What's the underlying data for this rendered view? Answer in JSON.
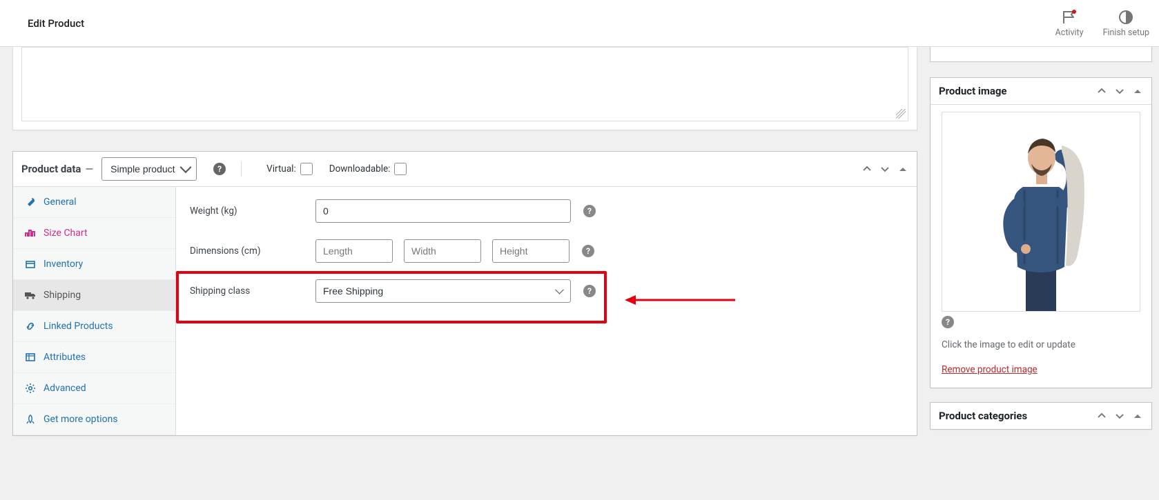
{
  "topbar": {
    "title": "Edit Product",
    "activity_label": "Activity",
    "finish_label": "Finish setup"
  },
  "product_data": {
    "title": "Product data",
    "dash": " — ",
    "type_select": "Simple product",
    "virtual_label": "Virtual:",
    "downloadable_label": "Downloadable:"
  },
  "tabs": {
    "general": "General",
    "size_chart": "Size Chart",
    "inventory": "Inventory",
    "shipping": "Shipping",
    "linked_products": "Linked Products",
    "attributes": "Attributes",
    "advanced": "Advanced",
    "get_more": "Get more options"
  },
  "shipping": {
    "weight_label": "Weight (kg)",
    "weight_value": "0",
    "dimensions_label": "Dimensions (cm)",
    "length_ph": "Length",
    "width_ph": "Width",
    "height_ph": "Height",
    "class_label": "Shipping class",
    "class_value": "Free Shipping"
  },
  "sidebar": {
    "product_image_title": "Product image",
    "image_hint": "Click the image to edit or update",
    "remove_link": "Remove product image",
    "categories_title": "Product categories"
  }
}
